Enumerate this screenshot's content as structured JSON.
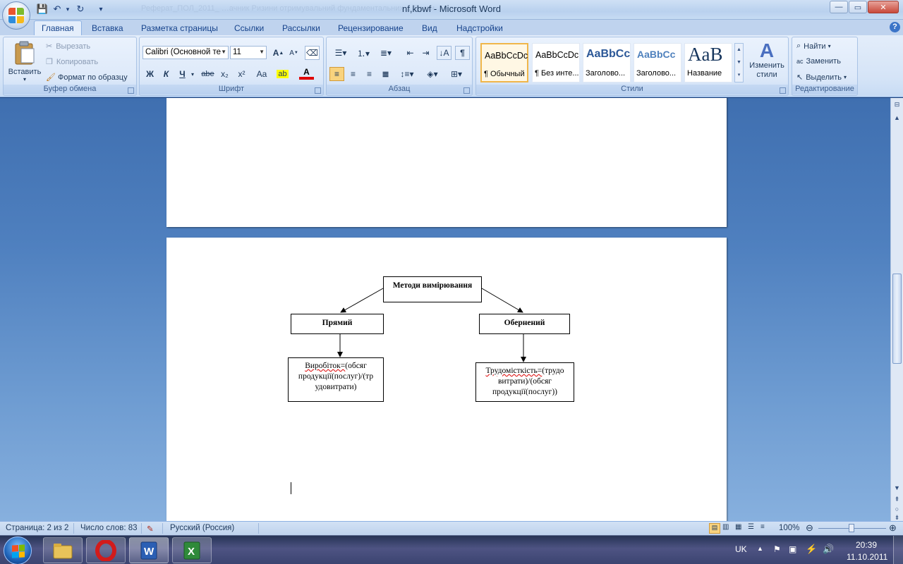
{
  "window": {
    "title": "nf,kbwf - Microsoft Word",
    "ghost_title": "Реферат_ПОЛ_2011_ …ачник Ризини отримувальний фундаментальних…      Вести  …ильнивр",
    "min_label": "—",
    "max_label": "▭",
    "close_label": "✕"
  },
  "qat": {
    "save": "💾",
    "undo": "↶",
    "repeat": "↻",
    "more": "▾"
  },
  "tabs": [
    {
      "label": "Главная"
    },
    {
      "label": "Вставка"
    },
    {
      "label": "Разметка страницы"
    },
    {
      "label": "Ссылки"
    },
    {
      "label": "Рассылки"
    },
    {
      "label": "Рецензирование"
    },
    {
      "label": "Вид"
    },
    {
      "label": "Надстройки"
    }
  ],
  "ribbon": {
    "clipboard": {
      "label": "Буфер обмена",
      "paste": "Вставить",
      "cut": "Вырезать",
      "copy": "Копировать",
      "format_painter": "Формат по образцу"
    },
    "font": {
      "label": "Шрифт",
      "font_name": "Calibri (Основной те",
      "font_size": "11",
      "bold": "Ж",
      "italic": "К",
      "underline": "Ч",
      "strike": "abe",
      "subscript": "x₂",
      "superscript": "x²",
      "case": "Aa"
    },
    "paragraph": {
      "label": "Абзац",
      "show_marks": "¶"
    },
    "styles": {
      "label": "Стили",
      "items": [
        {
          "sample": "AaBbCcDc",
          "name": "¶ Обычный"
        },
        {
          "sample": "AaBbCcDc",
          "name": "¶ Без инте..."
        },
        {
          "sample": "AaBbCc",
          "name": "Заголово..."
        },
        {
          "sample": "AaBbCc",
          "name": "Заголово..."
        },
        {
          "sample": "AaB",
          "name": "Название"
        }
      ],
      "change": "Изменить стили"
    },
    "editing": {
      "label": "Редактирование",
      "find": "Найти",
      "replace": "Заменить",
      "select": "Выделить"
    }
  },
  "diagram": {
    "root": "Методи вимірювання",
    "left": "Прямий",
    "right": "Обернений",
    "left_formula_word": "Виробіток=",
    "left_formula_rest": "(обсяг продукції(послуг)/(тр удовитрати)",
    "right_formula_word": "Трудомісткість=",
    "right_formula_rest": "(трудо витрати)/(обсяг продукції(послуг))"
  },
  "status": {
    "page": "Страница: 2 из 2",
    "words": "Число слов: 83",
    "language": "Русский (Россия)",
    "zoom": "100%"
  },
  "tray": {
    "lang": "UK",
    "time": "20:39",
    "date": "11.10.2011"
  },
  "colors": {
    "ribbon_bg": "#dbe8f8",
    "accent": "#15428b",
    "doc_bg": "#4f80bf"
  }
}
